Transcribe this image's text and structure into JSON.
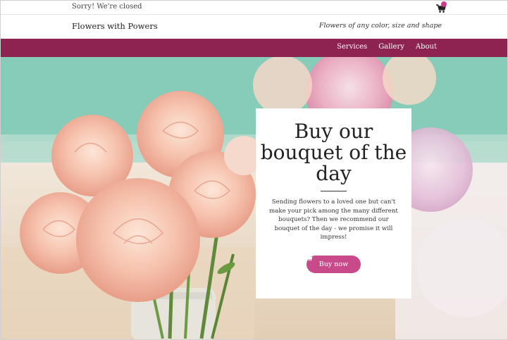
{
  "topbar": {
    "notice": "Sorry! We're closed",
    "cart_icon": "cart-icon"
  },
  "header": {
    "brand": "Flowers with Powers",
    "tagline": "Flowers of any color, size and shape"
  },
  "nav": {
    "items": [
      {
        "label": "Services"
      },
      {
        "label": "Gallery"
      },
      {
        "label": "About"
      }
    ]
  },
  "hero": {
    "title": "Buy our bouquet of the day",
    "description": "Sending flowers to a loved one but can't make your pick among the many different bouquets? Then we recommend our bouquet of the day - we promise it will impress!",
    "button_label": "Buy now",
    "button_icon": "cart-icon"
  },
  "colors": {
    "nav_bg": "#8c2350",
    "button_bg": "#c94a8a",
    "badge": "#d03a8a"
  }
}
